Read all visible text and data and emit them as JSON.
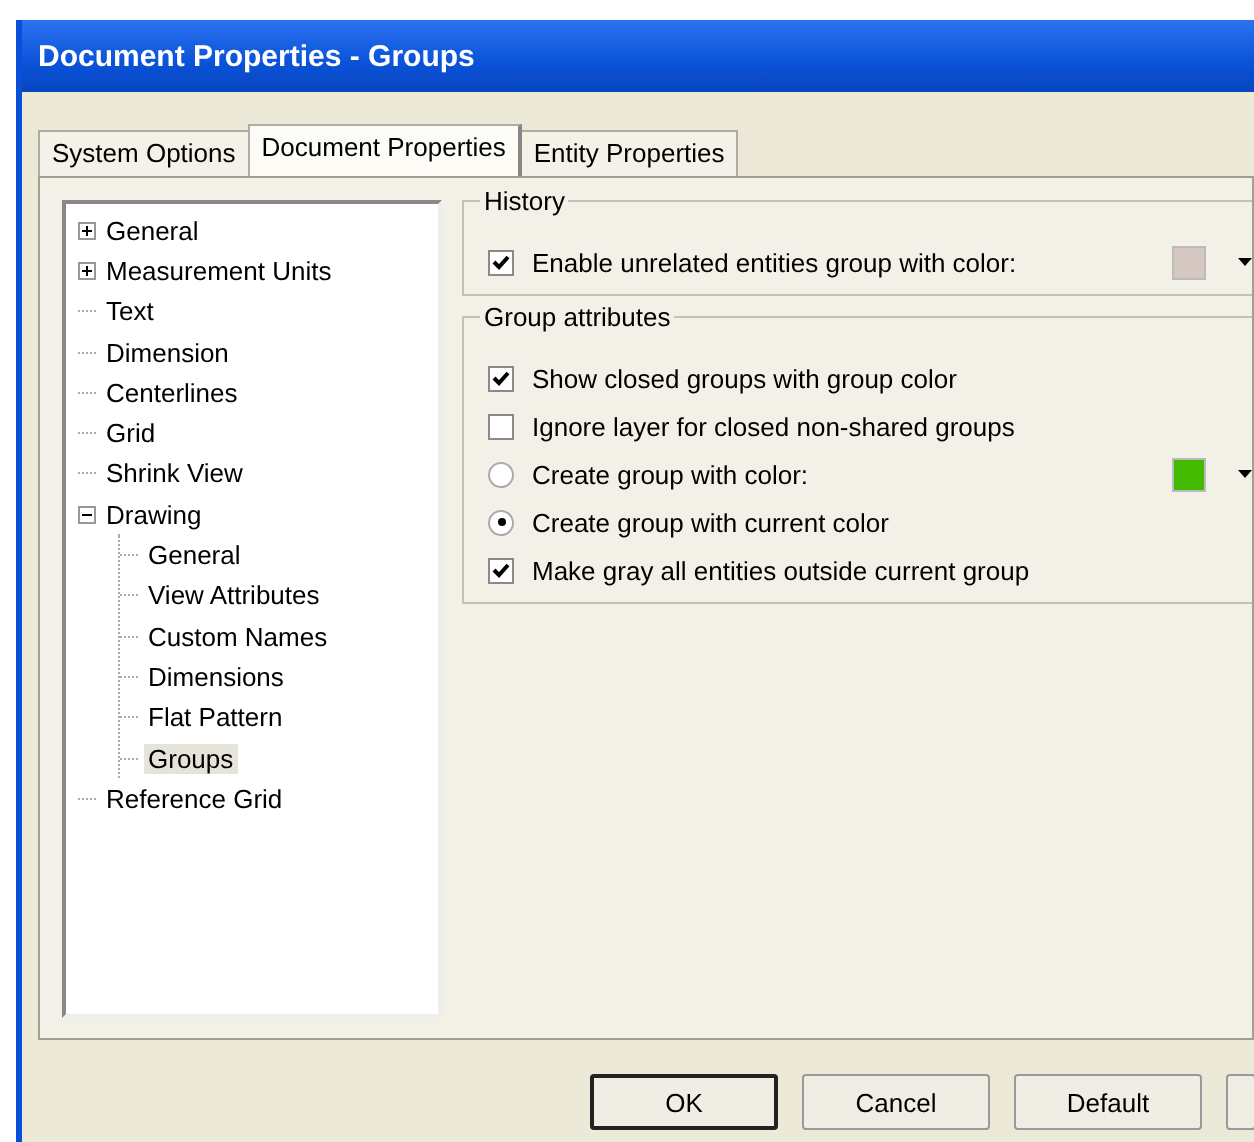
{
  "window": {
    "title": "Document Properties - Groups"
  },
  "tabs": [
    {
      "label": "System Options",
      "selected": false
    },
    {
      "label": "Document Properties",
      "selected": true
    },
    {
      "label": "Entity Properties",
      "selected": false
    }
  ],
  "tree": [
    {
      "label": "General",
      "expanded": false,
      "selected": false
    },
    {
      "label": "Measurement Units",
      "expanded": false,
      "selected": false
    },
    {
      "label": "Text",
      "selected": false
    },
    {
      "label": "Dimension",
      "selected": false
    },
    {
      "label": "Centerlines",
      "selected": false
    },
    {
      "label": "Grid",
      "selected": false
    },
    {
      "label": "Shrink View",
      "selected": false
    },
    {
      "label": "Drawing",
      "expanded": true,
      "selected": false,
      "children": [
        {
          "label": "General",
          "selected": false
        },
        {
          "label": "View Attributes",
          "selected": false
        },
        {
          "label": "Custom Names",
          "selected": false
        },
        {
          "label": "Dimensions",
          "selected": false
        },
        {
          "label": "Flat Pattern",
          "selected": false
        },
        {
          "label": "Groups",
          "selected": true
        }
      ]
    },
    {
      "label": "Reference Grid",
      "selected": false
    }
  ],
  "groups": [
    {
      "title": "History",
      "options": [
        {
          "kind": "checkbox",
          "label": "Enable unrelated entities group with color:",
          "checked": true,
          "color": "#d4c8c0"
        }
      ]
    },
    {
      "title": "Group attributes",
      "options": [
        {
          "kind": "checkbox",
          "label": "Show closed groups with group color",
          "checked": true
        },
        {
          "kind": "checkbox",
          "label": "Ignore layer for closed non-shared groups",
          "checked": false
        },
        {
          "kind": "radio",
          "label": "Create group with color:",
          "selected": false,
          "color": "#44bb00"
        },
        {
          "kind": "radio",
          "label": "Create group with current color",
          "selected": true
        },
        {
          "kind": "checkbox",
          "label": "Make gray all entities outside current group",
          "checked": true
        }
      ]
    }
  ],
  "buttons": [
    {
      "label": "OK",
      "default": true
    },
    {
      "label": "Cancel",
      "default": false
    },
    {
      "label": "Default",
      "default": false
    }
  ]
}
